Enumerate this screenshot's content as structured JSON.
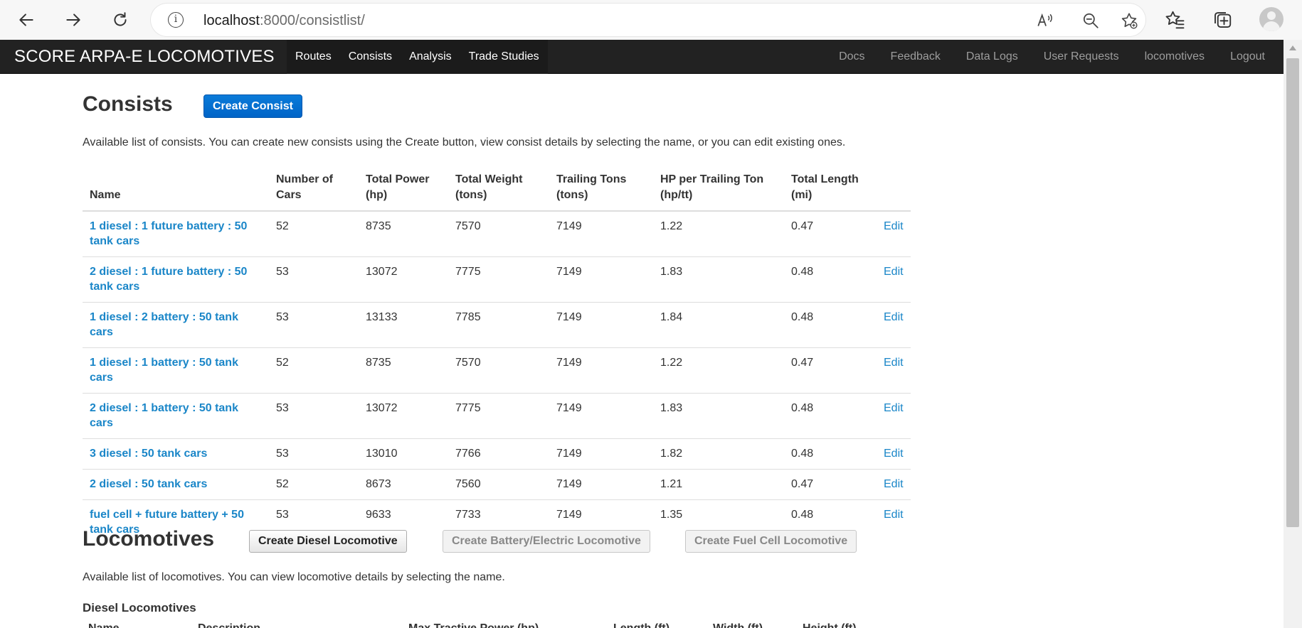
{
  "browser": {
    "url_host": "localhost",
    "url_rest": ":8000/consistlist/"
  },
  "navbar": {
    "brand": "SCORE ARPA-E LOCOMOTIVES",
    "left_items": [
      "Routes",
      "Consists",
      "Analysis",
      "Trade Studies"
    ],
    "right_items": [
      "Docs",
      "Feedback",
      "Data Logs",
      "User Requests",
      "locomotives",
      "Logout"
    ]
  },
  "consists": {
    "title": "Consists",
    "create_button": "Create Consist",
    "description": "Available list of consists. You can create new consists using the Create button, view consist details by selecting the name, or you can edit existing ones.",
    "columns": [
      "Name",
      "Number of Cars",
      "Total Power (hp)",
      "Total Weight (tons)",
      "Trailing Tons (tons)",
      "HP per Trailing Ton (hp/tt)",
      "Total Length (mi)"
    ],
    "edit_label": "Edit",
    "rows": [
      {
        "name": "1 diesel : 1 future battery : 50 tank cars",
        "cars": "52",
        "power": "8735",
        "weight": "7570",
        "trailing": "7149",
        "hptt": "1.22",
        "length": "0.47"
      },
      {
        "name": "2 diesel : 1 future battery : 50 tank cars",
        "cars": "53",
        "power": "13072",
        "weight": "7775",
        "trailing": "7149",
        "hptt": "1.83",
        "length": "0.48"
      },
      {
        "name": "1 diesel : 2 battery : 50 tank cars",
        "cars": "53",
        "power": "13133",
        "weight": "7785",
        "trailing": "7149",
        "hptt": "1.84",
        "length": "0.48"
      },
      {
        "name": "1 diesel : 1 battery : 50 tank cars",
        "cars": "52",
        "power": "8735",
        "weight": "7570",
        "trailing": "7149",
        "hptt": "1.22",
        "length": "0.47"
      },
      {
        "name": "2 diesel : 1 battery : 50 tank cars",
        "cars": "53",
        "power": "13072",
        "weight": "7775",
        "trailing": "7149",
        "hptt": "1.83",
        "length": "0.48"
      },
      {
        "name": "3 diesel : 50 tank cars",
        "cars": "53",
        "power": "13010",
        "weight": "7766",
        "trailing": "7149",
        "hptt": "1.82",
        "length": "0.48"
      },
      {
        "name": "2 diesel : 50 tank cars",
        "cars": "52",
        "power": "8673",
        "weight": "7560",
        "trailing": "7149",
        "hptt": "1.21",
        "length": "0.47"
      },
      {
        "name": "fuel cell + future battery + 50 tank cars",
        "cars": "53",
        "power": "9633",
        "weight": "7733",
        "trailing": "7149",
        "hptt": "1.35",
        "length": "0.48"
      }
    ]
  },
  "locomotives": {
    "title": "Locomotives",
    "create_diesel": "Create Diesel Locomotive",
    "create_battery": "Create Battery/Electric Locomotive",
    "create_fuel_cell": "Create Fuel Cell Locomotive",
    "description": "Available list of locomotives. You can view locomotive details by selecting the name.",
    "diesel_heading": "Diesel Locomotives",
    "diesel_columns": [
      "Name",
      "Description",
      "Max Tractive Power (hp)",
      "Length (ft)",
      "Width (ft)",
      "Height (ft)"
    ]
  }
}
